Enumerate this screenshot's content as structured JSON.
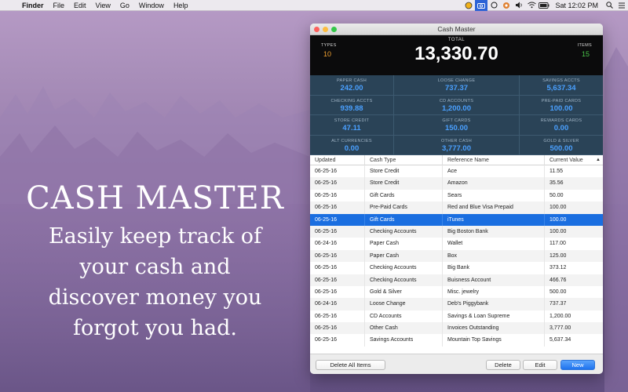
{
  "menubar": {
    "app_name": "Finder",
    "items": [
      "File",
      "Edit",
      "View",
      "Go",
      "Window",
      "Help"
    ],
    "clock": "Sat 12:02 PM"
  },
  "hero": {
    "title": "CASH MASTER",
    "lines": [
      "Easily keep track of",
      "your cash and",
      "discover money you",
      "forgot you had."
    ]
  },
  "window": {
    "title": "Cash Master",
    "summary": {
      "types_label": "TYPES",
      "types_value": "10",
      "total_label": "TOTAL",
      "total_value": "13,330.70",
      "items_label": "ITEMS",
      "items_value": "15"
    },
    "categories": [
      {
        "label": "PAPER CASH",
        "value": "242.00"
      },
      {
        "label": "LOOSE CHANGE",
        "value": "737.37"
      },
      {
        "label": "SAVINGS ACCTS",
        "value": "5,637.34"
      },
      {
        "label": "CHECKING ACCTS",
        "value": "939.88"
      },
      {
        "label": "CD ACCOUNTS",
        "value": "1,200.00"
      },
      {
        "label": "PRE-PAID CARDS",
        "value": "100.00"
      },
      {
        "label": "STORE CREDIT",
        "value": "47.11"
      },
      {
        "label": "GIFT CARDS",
        "value": "150.00"
      },
      {
        "label": "REWARDS CARDS",
        "value": "0.00"
      },
      {
        "label": "ALT CURRENCIES",
        "value": "0.00"
      },
      {
        "label": "OTHER CASH",
        "value": "3,777.00"
      },
      {
        "label": "GOLD & SILVER",
        "value": "500.00"
      }
    ],
    "table": {
      "columns": [
        "Updated",
        "Cash Type",
        "Reference Name",
        "Current Value"
      ],
      "selected_index": 4,
      "rows": [
        [
          "06-25-16",
          "Store Credit",
          "Ace",
          "11.55"
        ],
        [
          "06-25-16",
          "Store Credit",
          "Amazon",
          "35.56"
        ],
        [
          "06-25-16",
          "Gift Cards",
          "Sears",
          "50.00"
        ],
        [
          "06-25-16",
          "Pre-Paid Cards",
          "Red and Blue Visa Prepaid",
          "100.00"
        ],
        [
          "06-25-16",
          "Gift Cards",
          "iTunes",
          "100.00"
        ],
        [
          "06-25-16",
          "Checking Accounts",
          "Big Boston Bank",
          "100.00"
        ],
        [
          "06-24-16",
          "Paper Cash",
          "Wallet",
          "117.00"
        ],
        [
          "06-25-16",
          "Paper Cash",
          "Box",
          "125.00"
        ],
        [
          "06-25-16",
          "Checking Accounts",
          "Big Bank",
          "373.12"
        ],
        [
          "06-25-16",
          "Checking Accounts",
          "Buisness Account",
          "466.76"
        ],
        [
          "06-25-16",
          "Gold & Silver",
          "Misc. jewelry",
          "500.00"
        ],
        [
          "06-24-16",
          "Loose Change",
          "Deb's Piggybank",
          "737.37"
        ],
        [
          "06-25-16",
          "CD Accounts",
          "Savings & Loan Supreme",
          "1,200.00"
        ],
        [
          "06-25-16",
          "Other Cash",
          "Invoices Outstanding",
          "3,777.00"
        ],
        [
          "06-25-16",
          "Savings Accounts",
          "Mountain Top Savings",
          "5,637.34"
        ]
      ]
    },
    "buttons": {
      "delete_all": "Delete All Items",
      "delete": "Delete",
      "edit": "Edit",
      "new": "New"
    }
  }
}
